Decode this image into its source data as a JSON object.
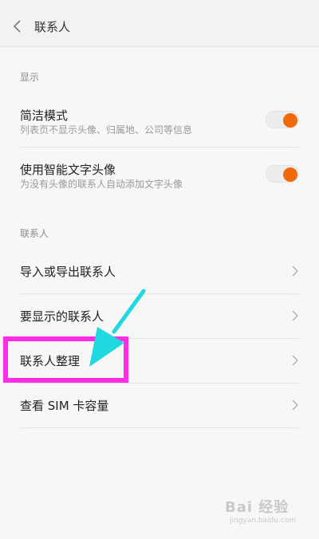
{
  "header": {
    "title": "联系人"
  },
  "sections": {
    "display": {
      "label": "显示"
    },
    "contacts": {
      "label": "联系人"
    }
  },
  "settings": {
    "simple_mode": {
      "title": "简洁模式",
      "subtitle": "列表页不显示头像、归属地、公司等信息",
      "enabled": true
    },
    "smart_avatar": {
      "title": "使用智能文字头像",
      "subtitle": "为没有头像的联系人自动添加文字头像",
      "enabled": true
    }
  },
  "menu": {
    "import_export": "导入或导出联系人",
    "visible_contacts": "要显示的联系人",
    "organize": "联系人整理",
    "sim_capacity": "查看 SIM 卡容量"
  },
  "watermark": {
    "brand": "Bai 经验",
    "url": "jingyan.baidu.com"
  },
  "colors": {
    "accent": "#f06a0b",
    "highlight": "#ff2de6",
    "arrow": "#20d8e0"
  }
}
